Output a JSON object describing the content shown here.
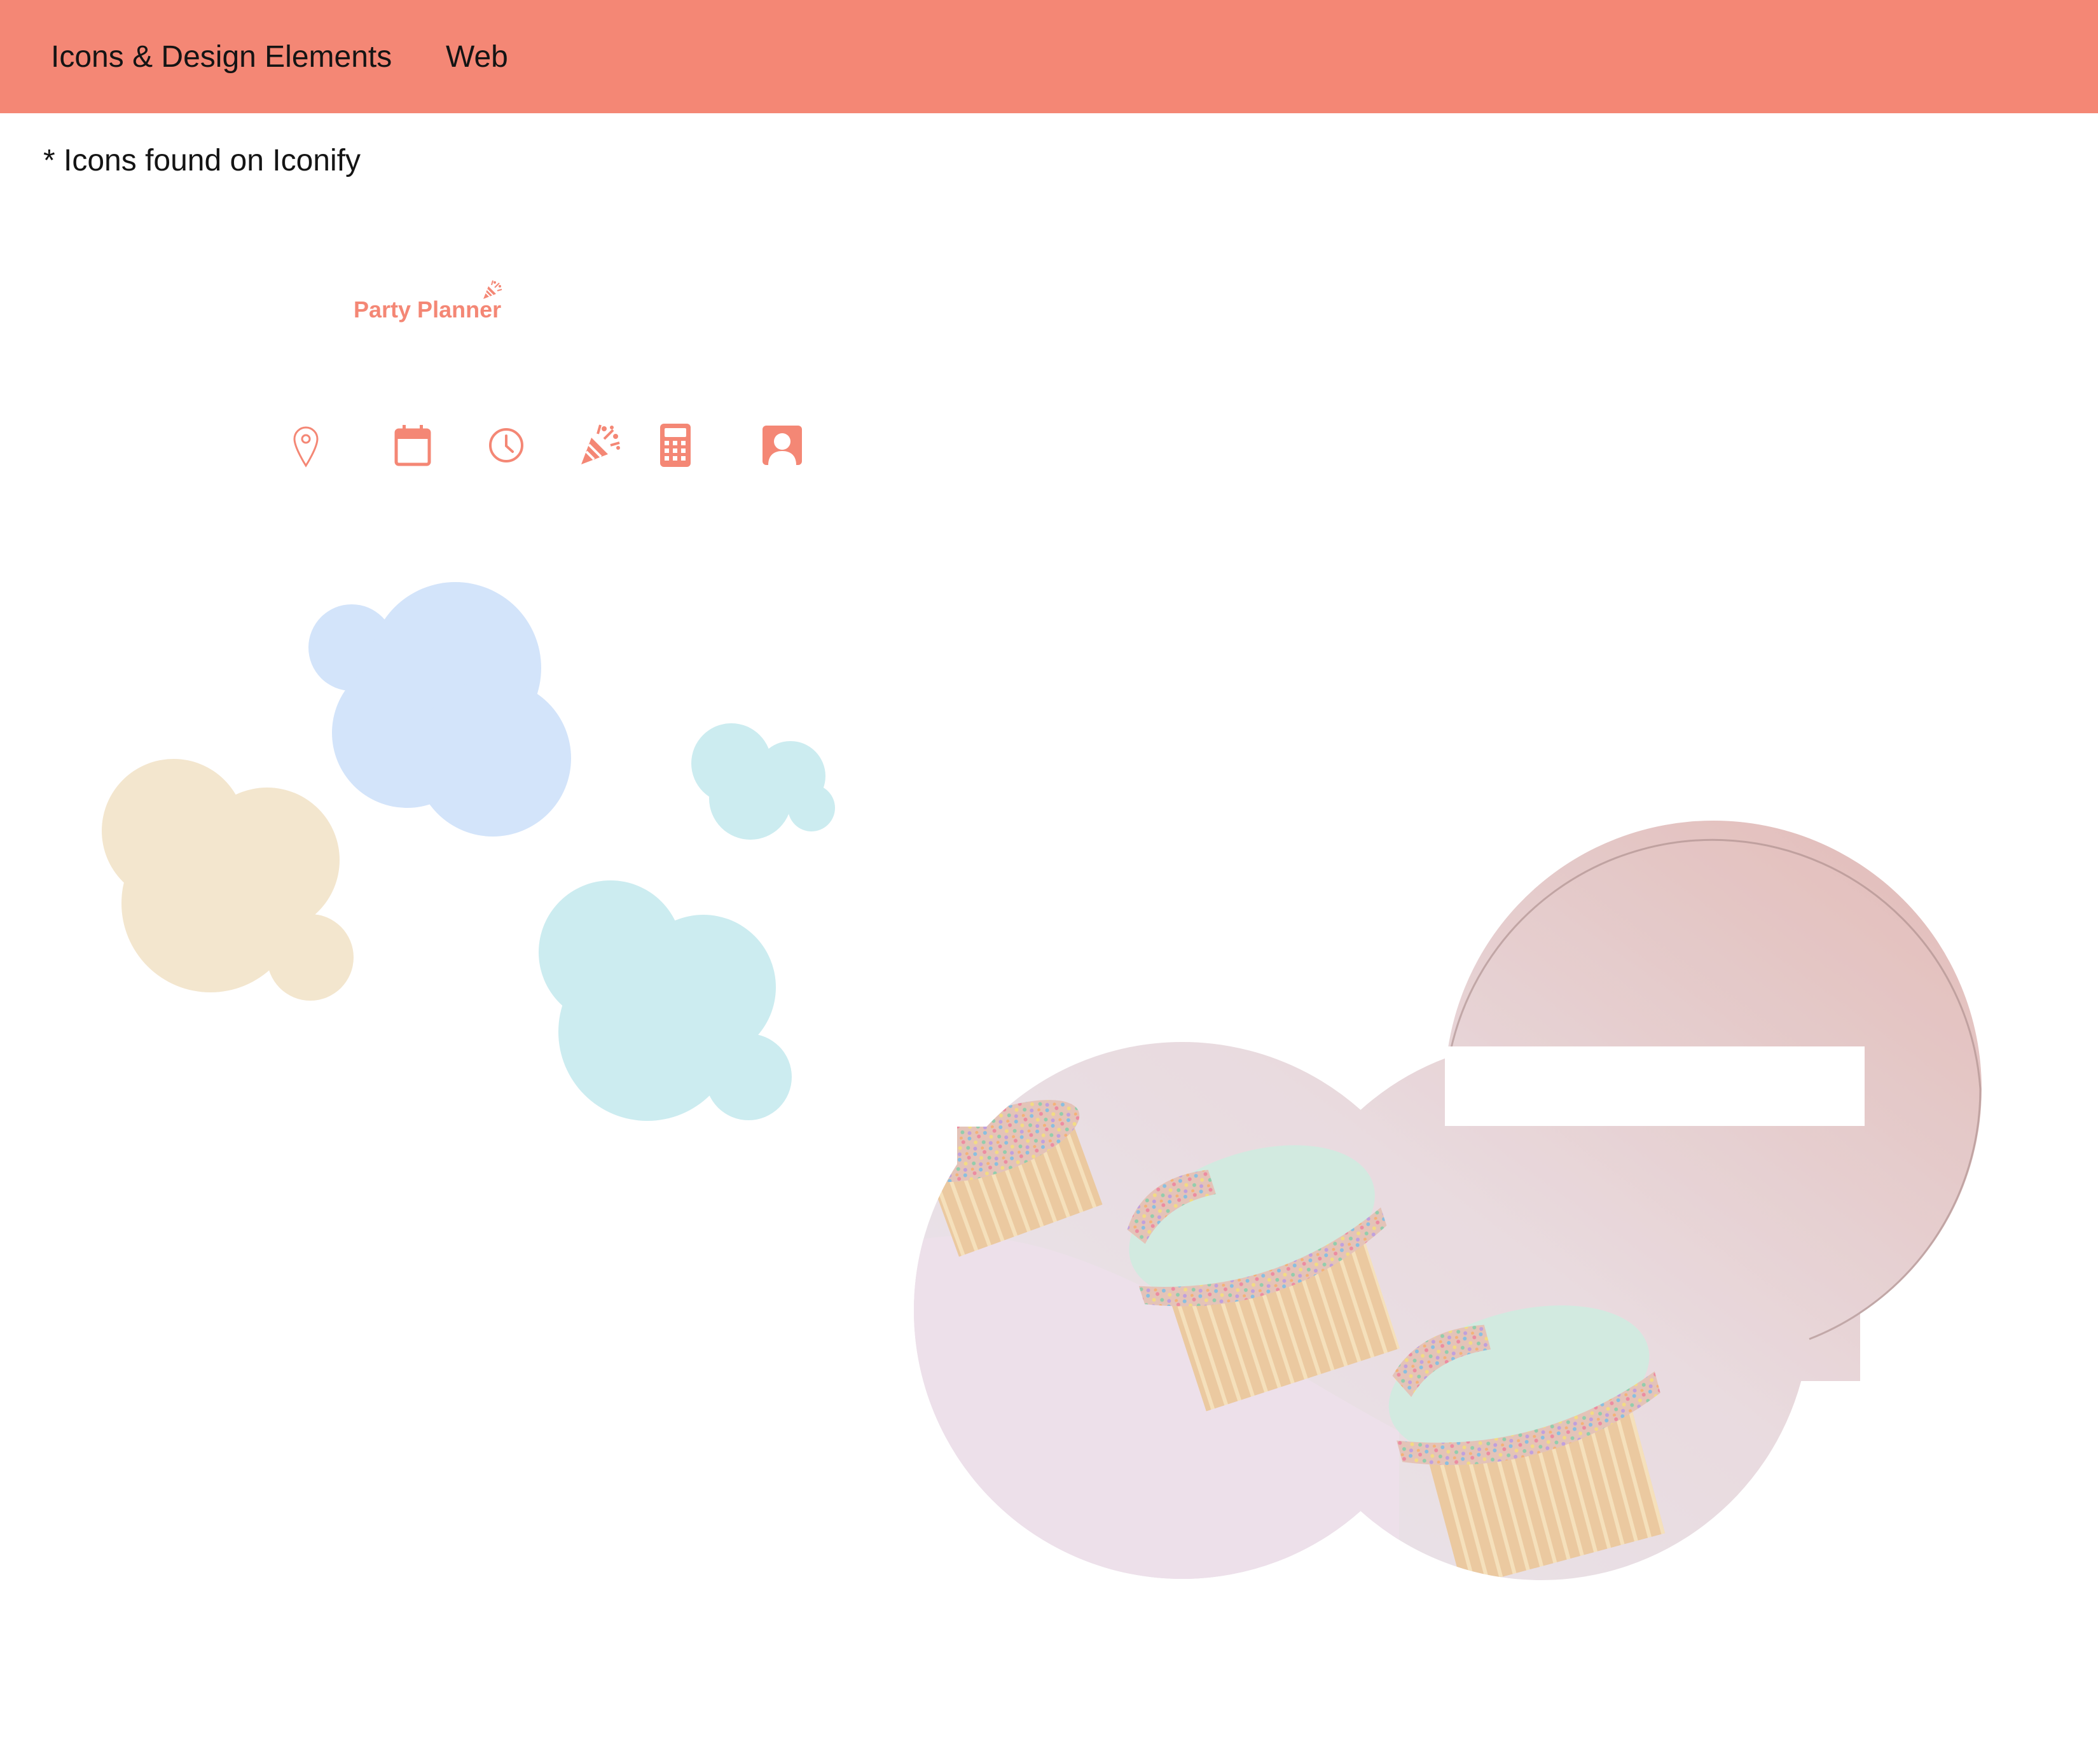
{
  "nav": {
    "tabs": [
      {
        "label": "Icons & Design Elements"
      },
      {
        "label": "Web"
      }
    ]
  },
  "note": "* Icons found on Iconify",
  "logo": {
    "text": "Party Planner",
    "icon": "party-popper-icon"
  },
  "icons": [
    {
      "name": "location-pin-icon"
    },
    {
      "name": "calendar-icon"
    },
    {
      "name": "clock-icon"
    },
    {
      "name": "party-popper-icon"
    },
    {
      "name": "calculator-icon"
    },
    {
      "name": "user-account-icon"
    }
  ],
  "colors": {
    "accent": "#f48775",
    "blob_blue": "#d3e4fa",
    "blob_cream": "#f3e6ce",
    "blob_teal": "#ccecf0",
    "photo_pink": "#e6c6c4",
    "photo_lavender": "#ece3ea",
    "frosting": "#c9e6da",
    "cake": "#e8c28f"
  }
}
